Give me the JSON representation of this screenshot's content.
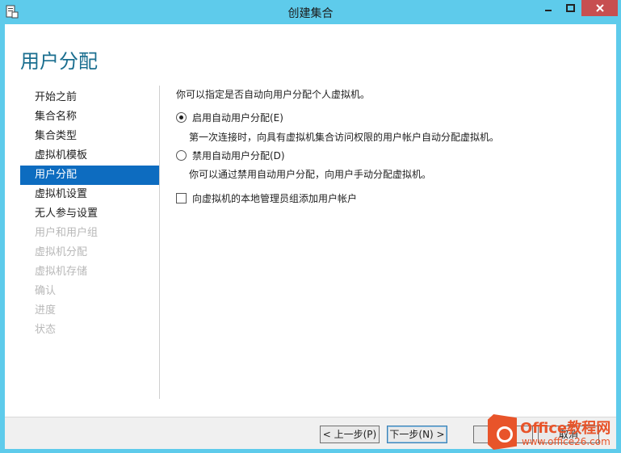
{
  "window": {
    "title": "创建集合",
    "minimize_icon": "minimize-icon",
    "maximize_icon": "maximize-icon",
    "close_icon": "close-icon"
  },
  "page": {
    "title": "用户分配"
  },
  "nav": {
    "items": [
      {
        "label": "开始之前",
        "state": "normal"
      },
      {
        "label": "集合名称",
        "state": "normal"
      },
      {
        "label": "集合类型",
        "state": "normal"
      },
      {
        "label": "虚拟机模板",
        "state": "normal"
      },
      {
        "label": "用户分配",
        "state": "active"
      },
      {
        "label": "虚拟机设置",
        "state": "normal"
      },
      {
        "label": "无人参与设置",
        "state": "normal"
      },
      {
        "label": "用户和用户组",
        "state": "disabled"
      },
      {
        "label": "虚拟机分配",
        "state": "disabled"
      },
      {
        "label": "虚拟机存储",
        "state": "disabled"
      },
      {
        "label": "确认",
        "state": "disabled"
      },
      {
        "label": "进度",
        "state": "disabled"
      },
      {
        "label": "状态",
        "state": "disabled"
      }
    ]
  },
  "main": {
    "intro": "你可以指定是否自动向用户分配个人虚拟机。",
    "options": [
      {
        "label": "启用自动用户分配(E)",
        "desc": "第一次连接时，向具有虚拟机集合访问权限的用户帐户自动分配虚拟机。",
        "selected": true
      },
      {
        "label": "禁用自动用户分配(D)",
        "desc": "你可以通过禁用自动用户分配，向用户手动分配虚拟机。",
        "selected": false
      }
    ],
    "checkbox": {
      "label": "向虚拟机的本地管理员组添加用户帐户",
      "checked": false
    }
  },
  "footer": {
    "prev_label": "< 上一步(P)",
    "next_label": "下一步(N) >",
    "cancel_label": "取消"
  },
  "watermark": {
    "line1": "Office教程网",
    "line2": "www.office26.com"
  },
  "colors": {
    "titlebar": "#5ecbeb",
    "accent": "#0d6cc0",
    "page_title": "#1a6e8f",
    "close": "#c74f50"
  }
}
